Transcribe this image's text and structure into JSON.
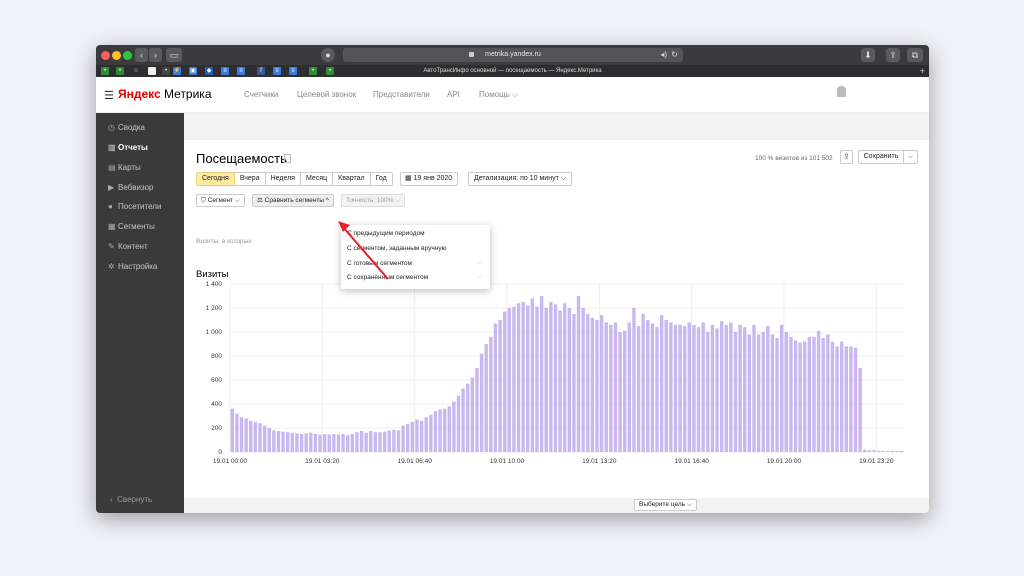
{
  "browser": {
    "url": "metrika.yandex.ru",
    "tab_title": "АвтоТрансИнфо основной — посещаемость — Яндекс.Метрика"
  },
  "header": {
    "logo_brand": "Яндекс",
    "logo_product": "Метрика",
    "nav": [
      "Счетчики",
      "Целевой звонок",
      "Представители",
      "API",
      "Помощь ⌵"
    ]
  },
  "sidebar": {
    "items": [
      {
        "label": "Сводка",
        "icon": "clock-icon"
      },
      {
        "label": "Отчеты",
        "icon": "bar-chart-icon"
      },
      {
        "label": "Карты",
        "icon": "map-icon"
      },
      {
        "label": "Вебвизор",
        "icon": "play-icon"
      },
      {
        "label": "Посетители",
        "icon": "person-icon"
      },
      {
        "label": "Сегменты",
        "icon": "segments-icon"
      },
      {
        "label": "Контент",
        "icon": "pen-icon"
      },
      {
        "label": "Настройка",
        "icon": "gear-icon"
      }
    ],
    "collapse_label": "Свернуть"
  },
  "report": {
    "title": "Посещаемость",
    "visits_info": "100 % визитов из 101 502",
    "save_label": "Сохранить",
    "periods": [
      "Сегодня",
      "Вчера",
      "Неделя",
      "Месяц",
      "Квартал",
      "Год"
    ],
    "selected_period": "Сегодня",
    "date_label": "19 янв 2020",
    "detail_label": "Детализация: по 10 минут ⌵",
    "segment_label": "Сегмент ⌵",
    "compare_label": "Сравнить сегменты ^",
    "accuracy_label": "Точность: 100% ⌵",
    "filter_text": "Визиты, в которых",
    "chart_title": "Визиты",
    "goal_label": "Выберите цель ⌵"
  },
  "compare_menu": {
    "items": [
      {
        "label": "С предыдущим периодом"
      },
      {
        "label": "С сегментом, заданным вручную"
      },
      {
        "label": "С готовым сегментом"
      },
      {
        "label": "С сохранённым сегментом"
      }
    ]
  },
  "colors": {
    "bar": "#c9b8ef",
    "sidebar": "#3a3a3a",
    "selected_period": "#ffeba0",
    "annotation_arrow": "#e8202a"
  },
  "chart_data": {
    "type": "bar",
    "ylim": [
      0,
      1400
    ],
    "yticks": [
      0,
      200,
      400,
      600,
      800,
      1000,
      1200,
      1400
    ],
    "xtick_labels": [
      "19.01 00:00",
      "19.01 03:20",
      "19.01 06:40",
      "19.01 10:00",
      "19.01 13:20",
      "19.01 16:40",
      "19.01 20:00",
      "19.01 23:20"
    ],
    "interval_minutes": 10,
    "series": [
      {
        "values": [
          360,
          320,
          290,
          280,
          260,
          250,
          240,
          220,
          200,
          180,
          175,
          170,
          165,
          160,
          155,
          150,
          155,
          160,
          150,
          145,
          150,
          145,
          150,
          145,
          150,
          140,
          150,
          165,
          175,
          160,
          175,
          165,
          165,
          170,
          180,
          185,
          180,
          220,
          235,
          250,
          270,
          260,
          290,
          310,
          340,
          355,
          360,
          380,
          420,
          470,
          530,
          570,
          620,
          700,
          820,
          900,
          960,
          1070,
          1100,
          1170,
          1200,
          1210,
          1240,
          1250,
          1220,
          1280,
          1210,
          1300,
          1200,
          1250,
          1230,
          1180,
          1240,
          1200,
          1150,
          1300,
          1200,
          1150,
          1120,
          1100,
          1140,
          1080,
          1060,
          1080,
          1000,
          1010,
          1080,
          1200,
          1050,
          1150,
          1100,
          1070,
          1040,
          1140,
          1100,
          1080,
          1060,
          1060,
          1050,
          1080,
          1060,
          1040,
          1080,
          1000,
          1060,
          1030,
          1090,
          1060,
          1080,
          1000,
          1060,
          1040,
          980,
          1060,
          980,
          1000,
          1050,
          980,
          950,
          1060,
          1000,
          960,
          930,
          910,
          920,
          960,
          960,
          1010,
          950,
          980,
          920,
          880,
          920,
          880,
          880,
          870,
          700,
          20,
          15,
          15,
          12,
          10,
          10,
          10,
          10,
          10
        ]
      }
    ]
  }
}
